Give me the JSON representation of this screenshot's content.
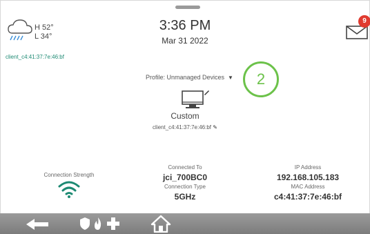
{
  "weather": {
    "high": "H 52°",
    "low": "L 34°"
  },
  "client_top": "client_c4:41:37:7e:46:bf",
  "clock": {
    "time": "3:36 PM",
    "date": "Mar 31 2022"
  },
  "notifications": {
    "count": "9"
  },
  "profile": {
    "label": "Profile: Unmanaged Devices"
  },
  "step_marker": "2",
  "device": {
    "name": "Custom",
    "client_id": "client_c4:41:37:7e:46:bf"
  },
  "connection": {
    "strength_label": "Connection Strength",
    "connected_to_label": "Connected To",
    "connected_to": "jci_700BC0",
    "type_label": "Connection Type",
    "type": "5GHz",
    "ip_label": "IP Address",
    "ip": "192.168.105.183",
    "mac_label": "MAC Address",
    "mac": "c4:41:37:7e:46:bf"
  },
  "colors": {
    "accent": "#6cc24a",
    "teal": "#1d8a73",
    "badge": "#e03a2f",
    "bar": "#8a8a8a"
  },
  "icons": [
    "cloud-rain-icon",
    "mail-icon",
    "monitor-icon",
    "edit-pencil-icon",
    "wifi-icon",
    "back-arrow-icon",
    "shield-icon",
    "flame-icon",
    "medical-cross-icon",
    "home-icon"
  ]
}
